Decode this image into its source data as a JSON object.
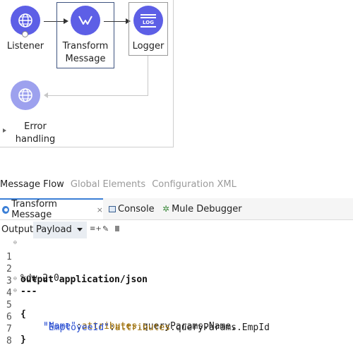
{
  "flow": {
    "listener_label": "Listener",
    "transform_label_line1": "Transform",
    "transform_label_line2": "Message",
    "logger_label": "Logger",
    "logger_icon_text": "LOG",
    "error_label_line1": "Error",
    "error_label_line2": "handling"
  },
  "view_tabs": {
    "message_flow": "Message Flow",
    "global_elements": "Global Elements",
    "configuration_xml": "Configuration XML"
  },
  "panel_tabs": {
    "transform": "Transform Message",
    "console": "Console",
    "debugger": "Mule Debugger"
  },
  "toolbar": {
    "output_label": "Output",
    "payload_value": "Payload"
  },
  "code": {
    "line_numbers": [
      "1",
      "2",
      "3",
      "4",
      "5",
      "6",
      "7",
      "8"
    ],
    "l1": "%dw 2.0",
    "l2": "output application/json",
    "l3": "---",
    "l4": "{",
    "l5_key": "\"Name\"",
    "l5_sep": ":",
    "l5_attr": "attributes",
    "l5_rest": ".queryParams.Name,",
    "l6_key": "\"EmployeeId\"",
    "l6_sep": ":",
    "l6_attr": "attributes",
    "l6_rest": ".queryParams.EmpId",
    "l7": "}"
  },
  "colors": {
    "node_icon": "#5d5fe6",
    "node_icon_disabled": "#9da1ee",
    "string": "#2a4fd1",
    "attribute": "#9a6a00",
    "active_tab_accent": "#3b7fd6"
  }
}
